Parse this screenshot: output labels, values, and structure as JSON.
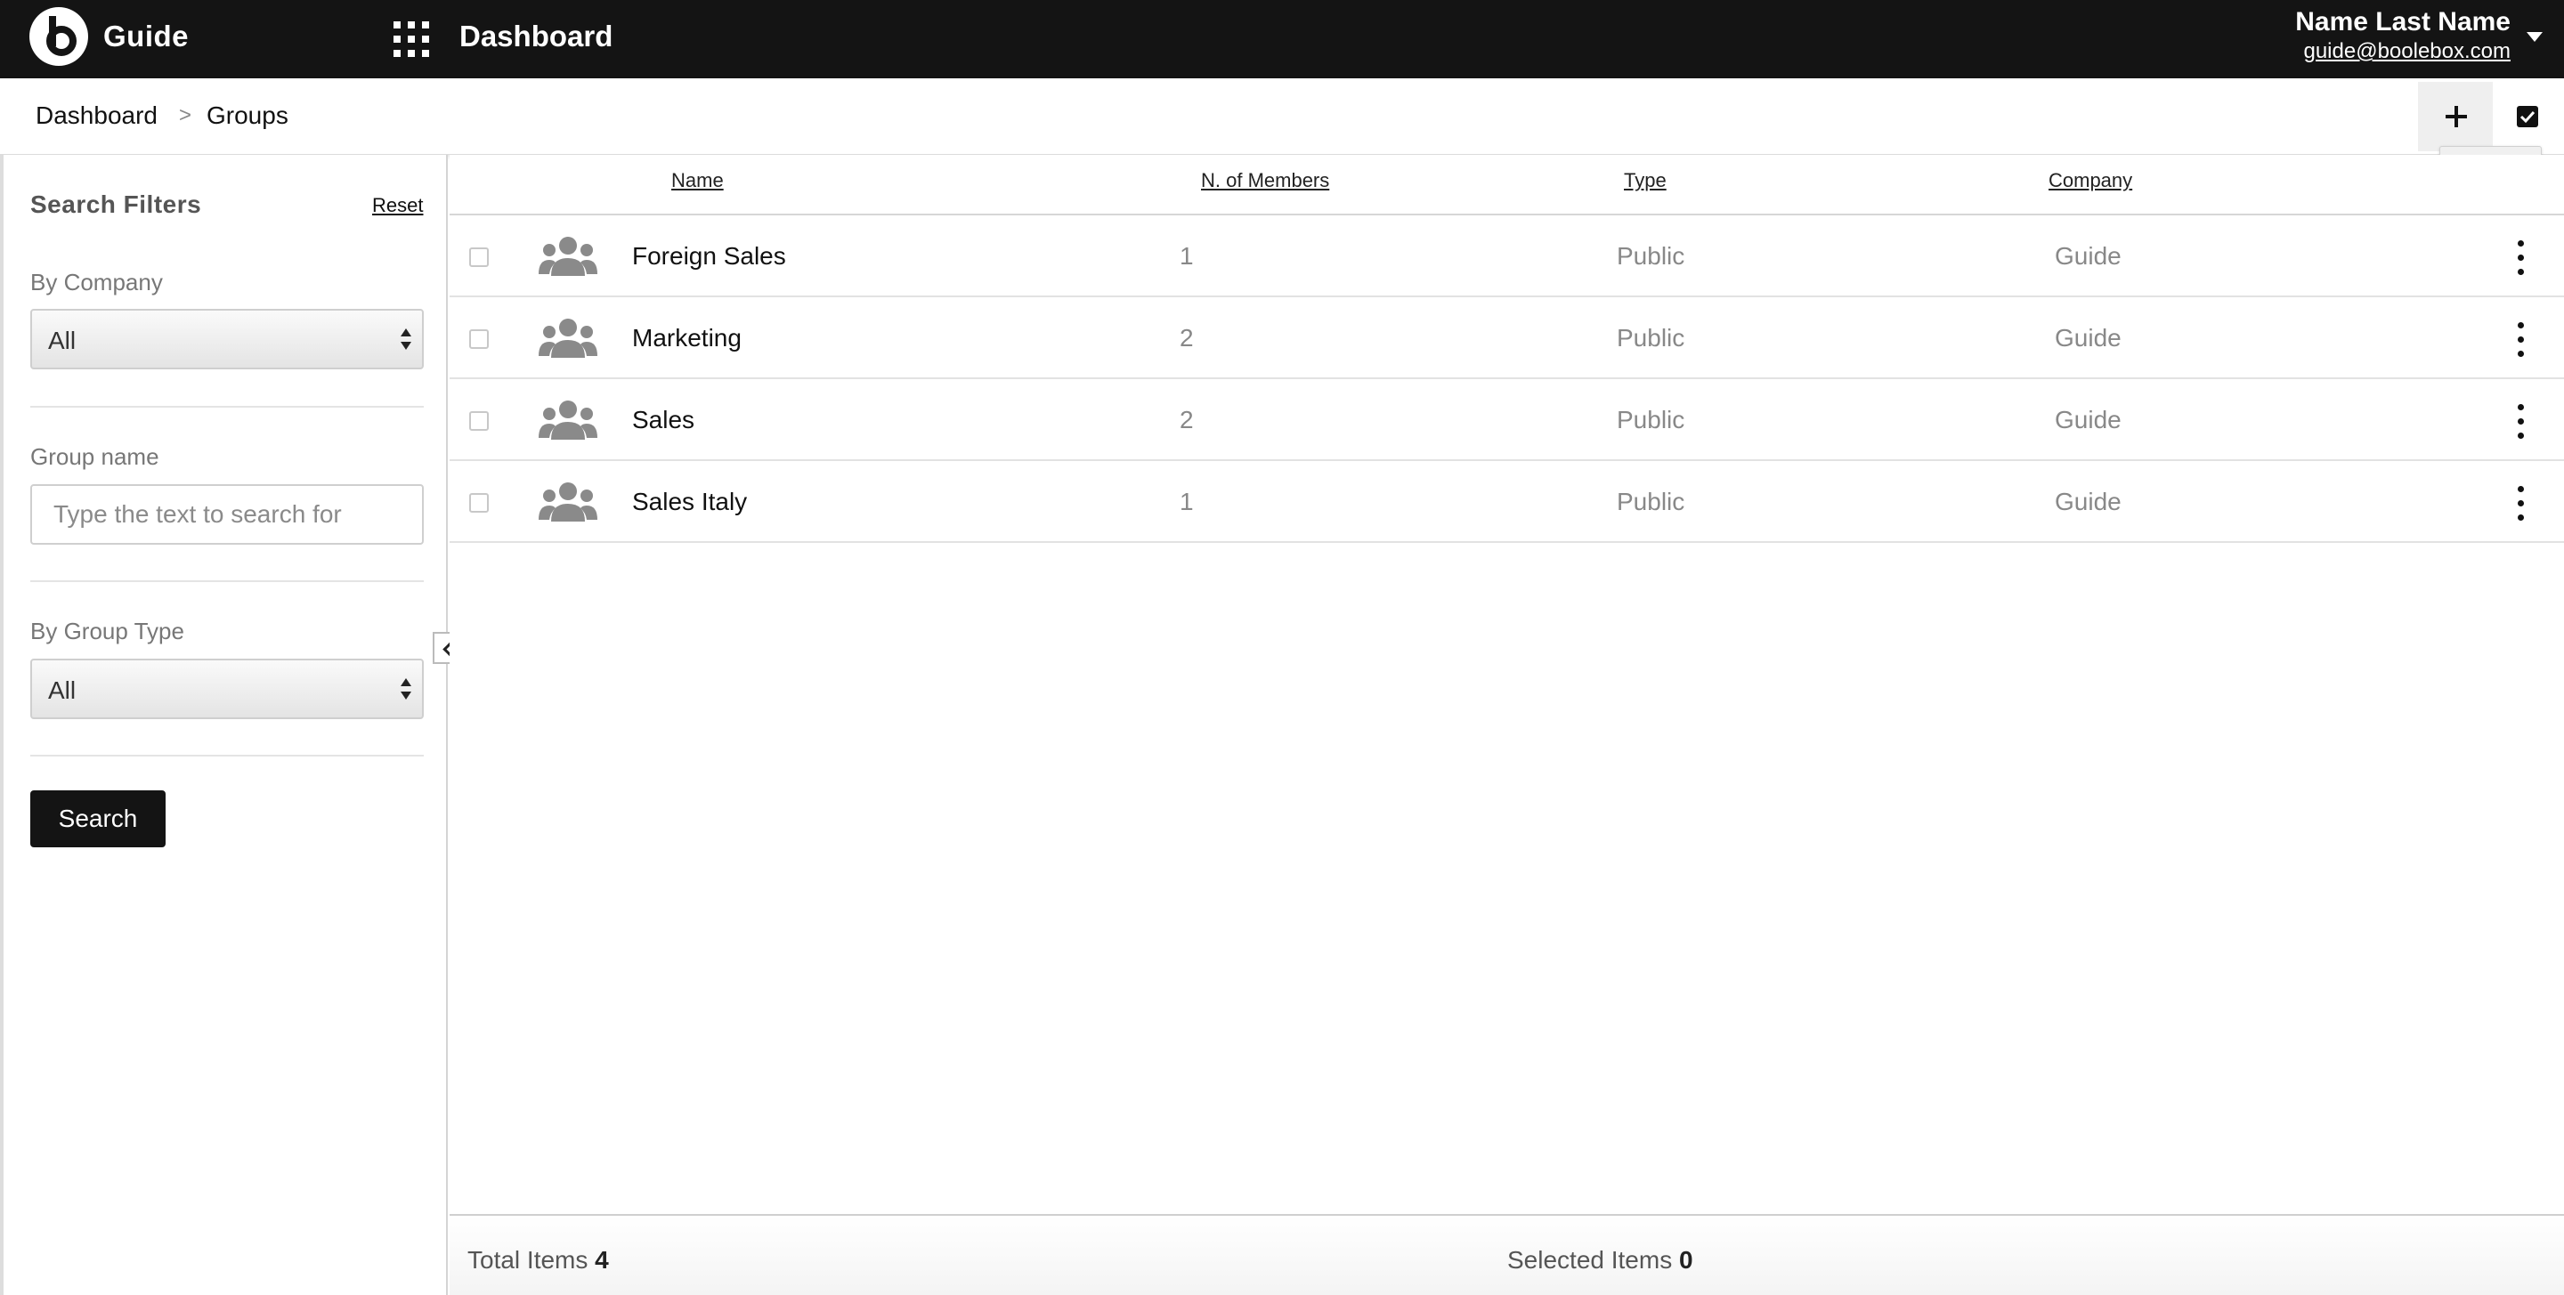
{
  "header": {
    "app_name": "Guide",
    "section_title": "Dashboard",
    "user_name": "Name Last Name",
    "user_email": "guide@boolebox.com"
  },
  "breadcrumb": {
    "items": [
      "Dashboard",
      "Groups"
    ],
    "separator": ">"
  },
  "toolbar": {
    "add_tooltip": "Add New"
  },
  "sidebar": {
    "title": "Search Filters",
    "reset_label": "Reset",
    "company_label": "By Company",
    "company_value": "All",
    "group_name_label": "Group name",
    "group_name_placeholder": "Type the text to search for",
    "group_type_label": "By Group Type",
    "group_type_value": "All",
    "search_label": "Search"
  },
  "table": {
    "columns": [
      "Name",
      "N. of Members",
      "Type",
      "Company"
    ],
    "rows": [
      {
        "name": "Foreign Sales",
        "members": "1",
        "type": "Public",
        "company": "Guide"
      },
      {
        "name": "Marketing",
        "members": "2",
        "type": "Public",
        "company": "Guide"
      },
      {
        "name": "Sales",
        "members": "2",
        "type": "Public",
        "company": "Guide"
      },
      {
        "name": "Sales Italy",
        "members": "1",
        "type": "Public",
        "company": "Guide"
      }
    ]
  },
  "footer": {
    "total_label": "Total Items",
    "total_value": "4",
    "selected_label": "Selected Items",
    "selected_value": "0"
  },
  "colors": {
    "topbar": "#141414",
    "accent_button": "#141414",
    "muted_text": "#888888"
  }
}
